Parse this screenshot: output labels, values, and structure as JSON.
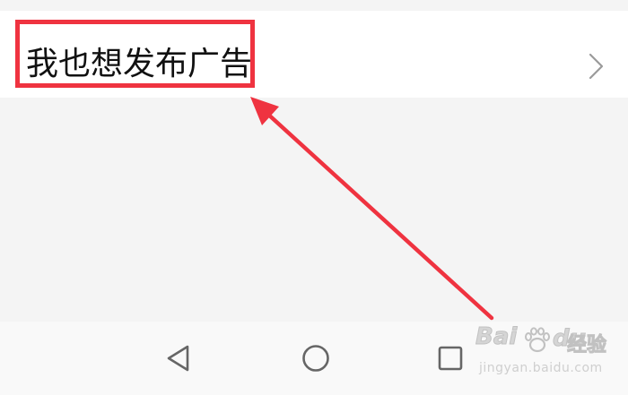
{
  "settings_item": {
    "label": "我也想发布广告",
    "chevron_icon": "chevron-right-icon"
  },
  "annotation": {
    "highlight_color": "#ef3340",
    "arrow_color": "#ef3340"
  },
  "navigation_bar": {
    "back_icon": "triangle-back-icon",
    "home_icon": "circle-home-icon",
    "recent_icon": "square-recent-apps-icon"
  },
  "watermark": {
    "brand_text": "Bai",
    "brand_suffix": "du",
    "brand_sub": "经验",
    "site": "jingyan.baidu.com"
  }
}
